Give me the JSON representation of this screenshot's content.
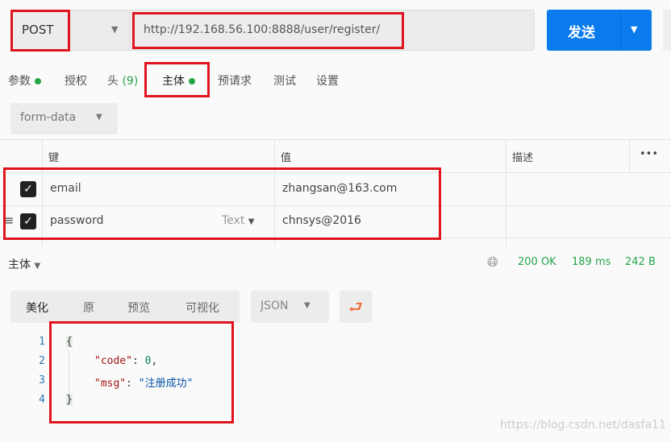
{
  "request": {
    "method": "POST",
    "url": "http://192.168.56.100:8888/user/register/",
    "send_label": "发送"
  },
  "tabs": [
    {
      "label": "参数",
      "dot": true
    },
    {
      "label": "授权"
    },
    {
      "label": "头",
      "count": "(9)"
    },
    {
      "label": "主体",
      "dot": true,
      "active": true
    },
    {
      "label": "预请求"
    },
    {
      "label": "测试"
    },
    {
      "label": "设置"
    }
  ],
  "body_type": "form-data",
  "table": {
    "headers": [
      "键",
      "值",
      "描述"
    ],
    "more": "•••",
    "rows": [
      {
        "key": "email",
        "value": "zhangsan@163.com",
        "checked": true
      },
      {
        "key": "password",
        "type": "Text",
        "value": "chnsys@2016",
        "checked": true
      }
    ]
  },
  "response": {
    "label": "主体",
    "status": "200 OK",
    "time": "189 ms",
    "size": "242 B",
    "view_tabs": [
      "美化",
      "原",
      "预览",
      "可视化"
    ],
    "format": "JSON",
    "lines": [
      "1",
      "2",
      "3",
      "4"
    ],
    "code": {
      "open": "{",
      "code_key": "\"code\"",
      "code_val": "0",
      "msg_key": "\"msg\"",
      "msg_val": "\"注册成功\"",
      "close": "}"
    }
  },
  "watermark": "https://blog.csdn.net/dasfa11",
  "colors": {
    "accent": "#097bed",
    "success": "#26a54a",
    "highlight": "#e0141e",
    "wrap": "#f26b3a"
  }
}
